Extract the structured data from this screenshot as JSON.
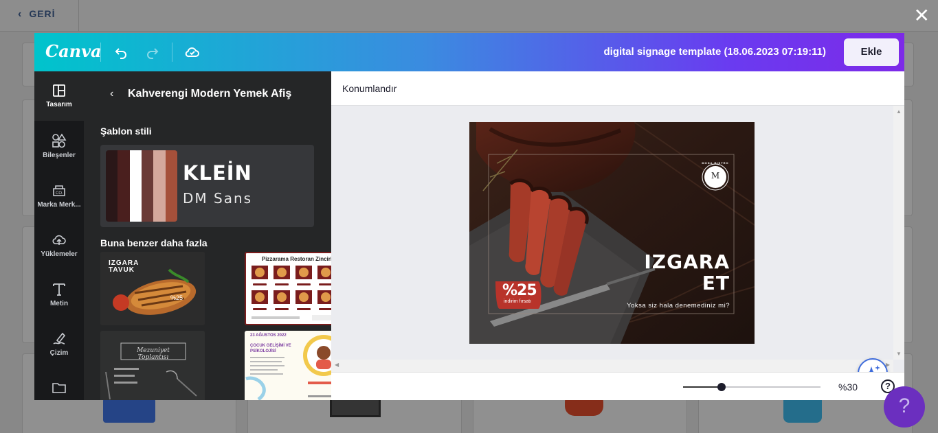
{
  "background": {
    "back_label": "GERİ"
  },
  "modal": {
    "logo": "Canva",
    "doc_title": "digital signage template (18.06.2023 07:19:11)",
    "add_button": "Ekle"
  },
  "rail": {
    "items": [
      {
        "label": "Tasarım",
        "icon": "layout-icon"
      },
      {
        "label": "Bileşenler",
        "icon": "shapes-icon"
      },
      {
        "label": "Marka Merk...",
        "icon": "brand-icon"
      },
      {
        "label": "Yüklemeler",
        "icon": "cloud-upload-icon"
      },
      {
        "label": "Metin",
        "icon": "text-icon"
      },
      {
        "label": "Çizim",
        "icon": "draw-icon"
      },
      {
        "label": "",
        "icon": "folder-icon"
      }
    ]
  },
  "panel": {
    "title": "Kahverengi Modern Yemek Afiş",
    "style_section": "Şablon stili",
    "style_name": "KLEİN",
    "style_font": "DM Sans",
    "palette": [
      "#2a1718",
      "#4a1f1e",
      "#ffffff",
      "#6a3a36",
      "#d4a89c",
      "#a5503a"
    ],
    "similar_section": "Buna benzer daha fazla",
    "thumbnails": {
      "t1_title": "IZGARA TAVUK",
      "t1_badge": "%25",
      "t2_title": "Pizzarama Restoran Zinciri",
      "t3_title": "Mezuniyet Toplantısı",
      "t4_date": "23 AĞUSTOS 2022",
      "t4_title": "ÇOCUK GELİŞİMİ VE PSİKOLOJİSİ"
    }
  },
  "editor": {
    "toolbar_label": "Konumlandır",
    "zoom_label": "%30",
    "zoom_value_percent": 30,
    "help": "?"
  },
  "design": {
    "title_line1": "IZGARA",
    "title_line2": "ET",
    "tagline": "Yoksa siz hala denemediniz mi?",
    "discount": "%25",
    "discount_sub": "indirim fırsatı",
    "brand_letter": "M",
    "brand_ring": "MODA BISTRO"
  },
  "chat": {
    "label": "?"
  }
}
